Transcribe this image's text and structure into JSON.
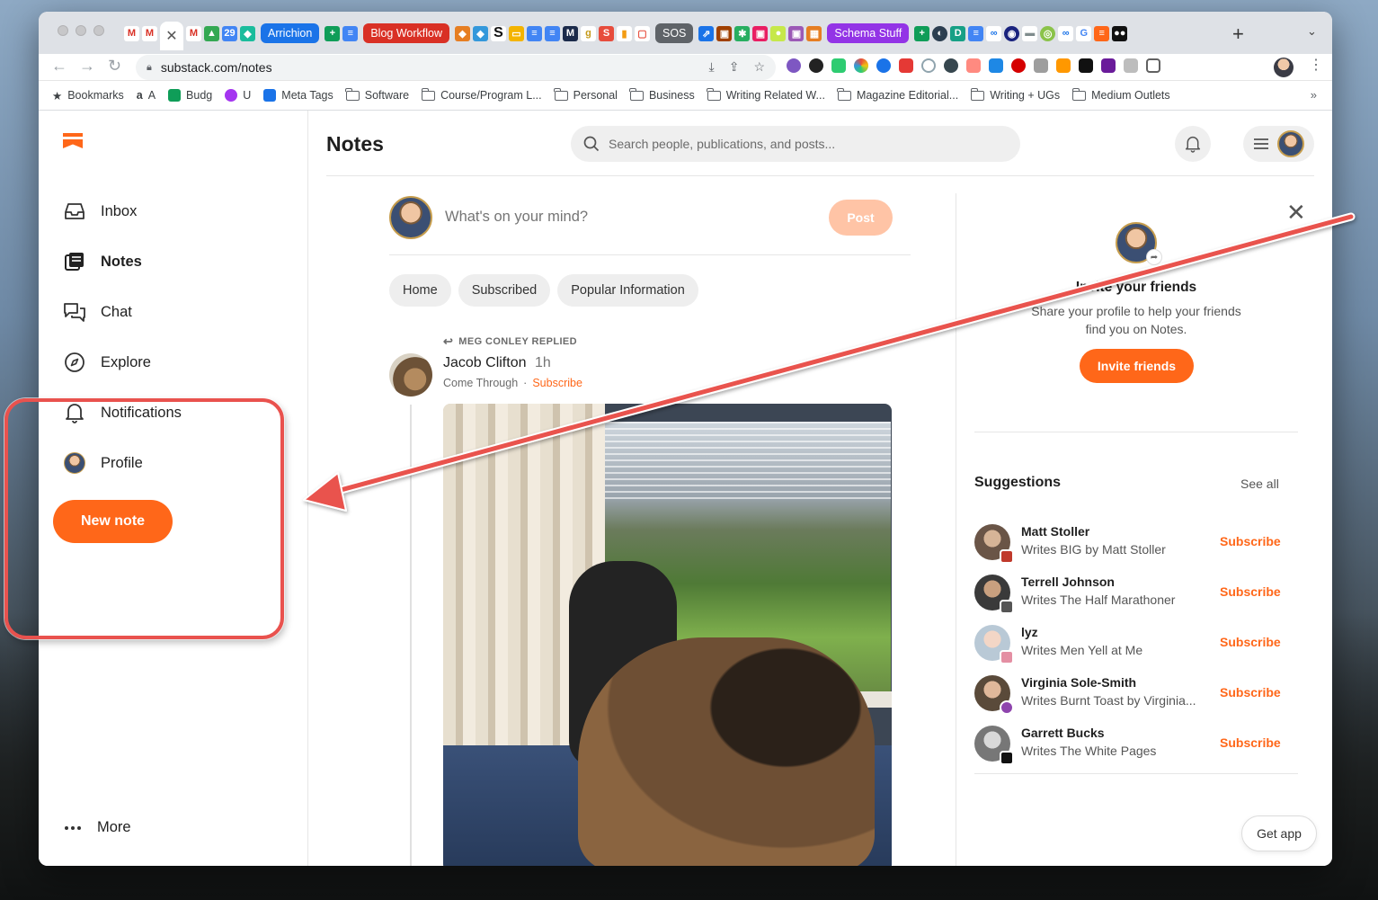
{
  "browser": {
    "tab_groups": [
      {
        "label": "Arrichion",
        "color": "#1a73e8"
      },
      {
        "label": "Blog Workflow",
        "color": "#d93025"
      },
      {
        "label": "SOS",
        "color": "#5f6368"
      },
      {
        "label": "Schema Stuff",
        "color": "#9334e6"
      }
    ],
    "url": "substack.com/notes",
    "bookmarks": [
      {
        "label": "Bookmarks",
        "icon": "star-icon"
      },
      {
        "label": "A",
        "icon": "amazon-icon"
      },
      {
        "label": "Budg",
        "icon": "sheets-icon"
      },
      {
        "label": "U",
        "icon": "udemy-icon"
      },
      {
        "label": "Meta Tags",
        "icon": "meta-tags-icon"
      },
      {
        "label": "Software",
        "icon": "folder-icon"
      },
      {
        "label": "Course/Program L...",
        "icon": "folder-icon"
      },
      {
        "label": "Personal",
        "icon": "folder-icon"
      },
      {
        "label": "Business",
        "icon": "folder-icon"
      },
      {
        "label": "Writing Related W...",
        "icon": "folder-icon"
      },
      {
        "label": "Magazine Editorial...",
        "icon": "folder-icon"
      },
      {
        "label": "Writing + UGs",
        "icon": "folder-icon"
      },
      {
        "label": "Medium Outlets",
        "icon": "folder-icon"
      }
    ]
  },
  "sidebar": {
    "items": [
      {
        "label": "Inbox",
        "icon": "inbox-icon"
      },
      {
        "label": "Notes",
        "icon": "notes-icon",
        "active": true
      },
      {
        "label": "Chat",
        "icon": "chat-icon"
      },
      {
        "label": "Explore",
        "icon": "compass-icon"
      },
      {
        "label": "Notifications",
        "icon": "bell-icon"
      },
      {
        "label": "Profile",
        "icon": "avatar"
      }
    ],
    "new_note": "New note",
    "more": "More"
  },
  "header": {
    "title": "Notes",
    "search_placeholder": "Search people, publications, and posts..."
  },
  "composer": {
    "placeholder": "What's on your mind?",
    "post": "Post"
  },
  "feed_tabs": [
    "Home",
    "Subscribed",
    "Popular Information"
  ],
  "post": {
    "reply_context": "MEG CONLEY REPLIED",
    "author": "Jacob Clifton",
    "time": "1h",
    "publication": "Come Through",
    "subscribe": "Subscribe"
  },
  "invite": {
    "title": "Invite your friends",
    "description": "Share your profile to help your friends find you on Notes.",
    "button": "Invite friends"
  },
  "suggestions": {
    "title": "Suggestions",
    "see_all": "See all",
    "items": [
      {
        "name": "Matt Stoller",
        "desc": "Writes BIG by Matt Stoller",
        "action": "Subscribe",
        "mini": "#c0392b"
      },
      {
        "name": "Terrell Johnson",
        "desc": "Writes The Half Marathoner",
        "action": "Subscribe",
        "mini": "#555555"
      },
      {
        "name": "lyz",
        "desc": "Writes Men Yell at Me",
        "action": "Subscribe",
        "mini": "#e48fa3"
      },
      {
        "name": "Virginia Sole-Smith",
        "desc": "Writes Burnt Toast by Virginia...",
        "action": "Subscribe",
        "mini": "#8e44ad"
      },
      {
        "name": "Garrett Bucks",
        "desc": "Writes The White Pages",
        "action": "Subscribe",
        "mini": "#111111"
      }
    ]
  },
  "get_app": "Get app",
  "annotation": {
    "color": "#e9524e"
  }
}
